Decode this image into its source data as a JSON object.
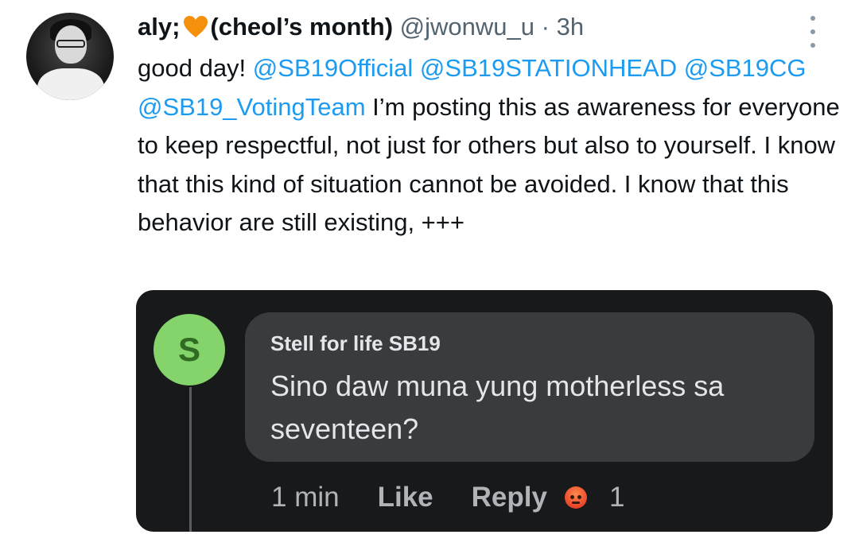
{
  "tweet": {
    "display_name_prefix": "aly;",
    "display_name_suffix": "(cheol’s month)",
    "heart_icon": "orange-heart-icon",
    "handle": "@jwonwu_u",
    "separator": "·",
    "time": "3h",
    "text_start": "good day!",
    "mentions": [
      "@SB19Official",
      "@SB19STATIONHEAD",
      "@SB19CG",
      "@SB19_VotingTeam"
    ],
    "text_body": "I’m posting this as awareness for everyone to keep respectful, not just for others but also to yourself. I know that this kind of situation cannot be avoided. I know that this behavior are still existing, +++",
    "colors": {
      "mention": "#1d9bf0",
      "heart": "#f4900c",
      "muted": "#536471"
    }
  },
  "embedded_comment": {
    "avatar_letter": "S",
    "avatar_color": "#85d36b",
    "author": "Stell for life SB19",
    "text": "Sino daw muna yung motherless sa seventeen?",
    "time": "1 min",
    "like_label": "Like",
    "reply_label": "Reply",
    "reaction_icon": "angry-reaction-icon",
    "reaction_count": "1"
  }
}
